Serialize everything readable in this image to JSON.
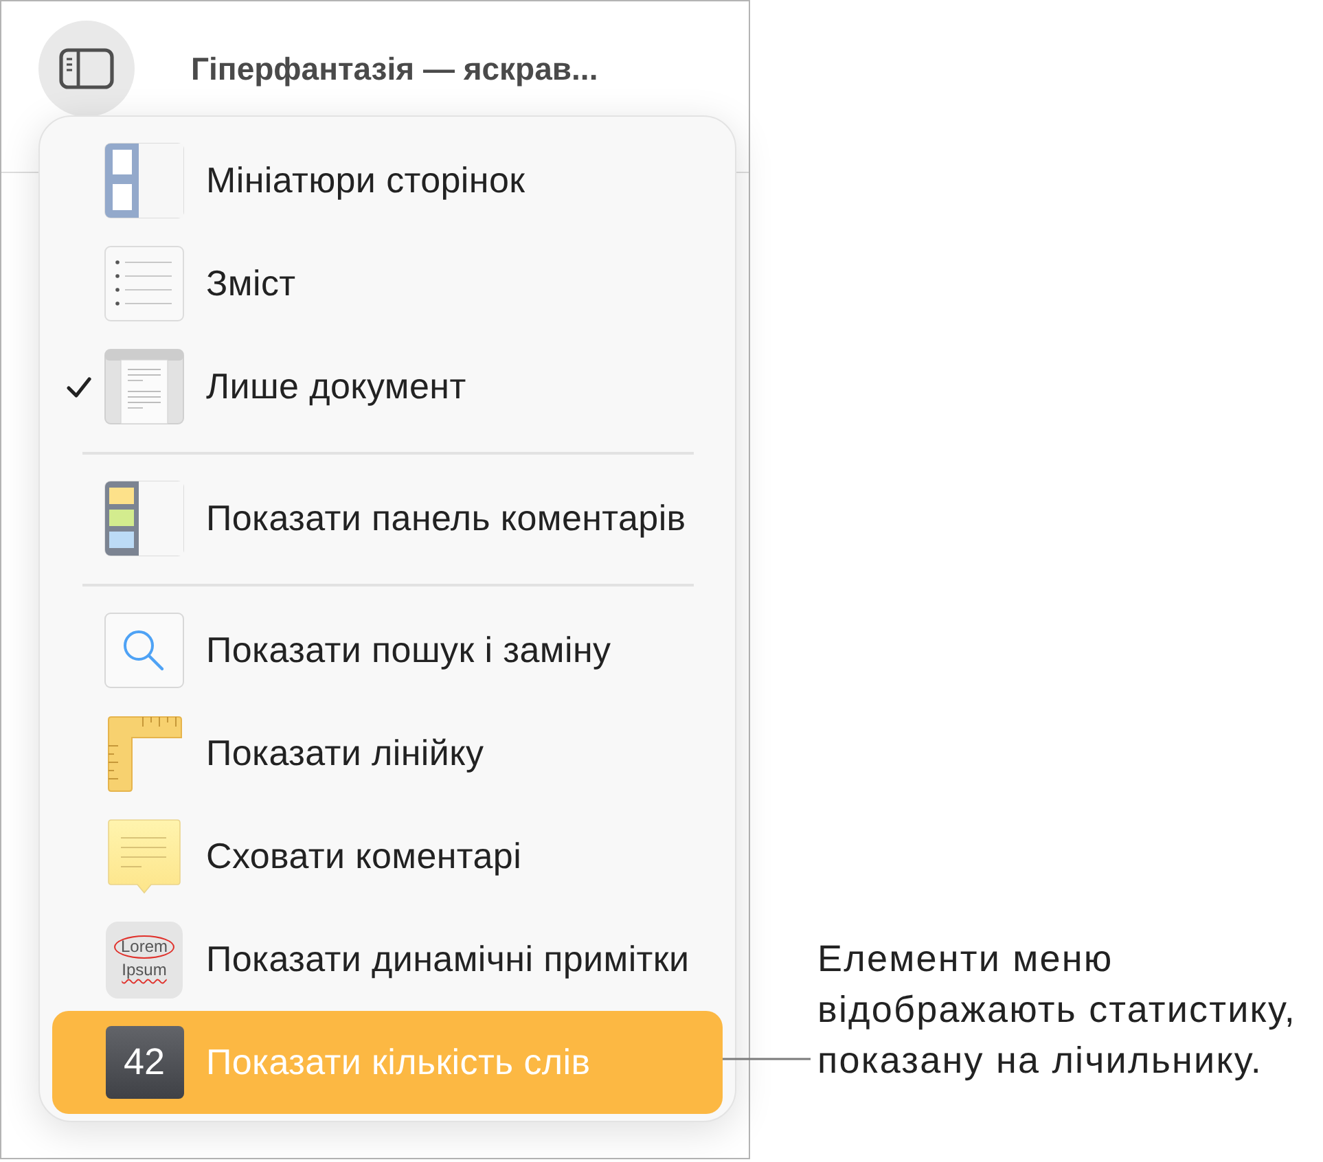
{
  "window": {
    "title": "Гіперфантазія — яскрав..."
  },
  "menu": {
    "sections": [
      {
        "items": [
          {
            "kind": "thumbnails",
            "label": "Мініатюри сторінок",
            "checked": false,
            "selected": false
          },
          {
            "kind": "contents",
            "label": "Зміст",
            "checked": false,
            "selected": false
          },
          {
            "kind": "document",
            "label": "Лише документ",
            "checked": true,
            "selected": false
          }
        ]
      },
      {
        "items": [
          {
            "kind": "comments_panel",
            "label": "Показати панель коментарів",
            "checked": false,
            "selected": false
          }
        ]
      },
      {
        "items": [
          {
            "kind": "search",
            "label": "Показати пошук і заміну",
            "checked": false,
            "selected": false
          },
          {
            "kind": "ruler",
            "label": "Показати лінійку",
            "checked": false,
            "selected": false
          },
          {
            "kind": "comment",
            "label": "Сховати коментарі",
            "checked": false,
            "selected": false
          },
          {
            "kind": "annotations",
            "label": "Показати динамічні примітки",
            "icon_text": [
              "Lorem",
              "Ipsum"
            ],
            "checked": false,
            "selected": false
          },
          {
            "kind": "word_count",
            "label": "Показати кількість слів",
            "icon_text": [
              "42"
            ],
            "checked": false,
            "selected": true
          }
        ]
      }
    ]
  },
  "callout": {
    "text": "Елементи меню відображають статистику, показану на лічильнику."
  }
}
